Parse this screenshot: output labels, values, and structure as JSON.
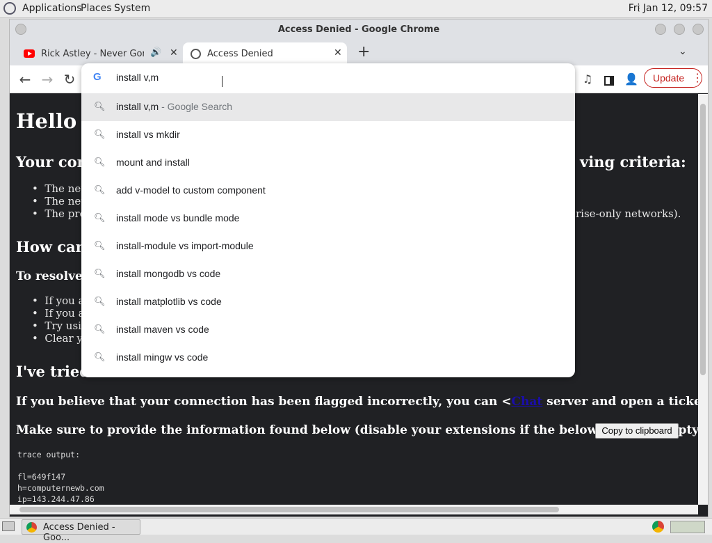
{
  "panel": {
    "menus": [
      "Applications",
      "Places",
      "System"
    ],
    "clock": "Fri Jan 12, 09:57"
  },
  "window": {
    "title": "Access Denied - Google Chrome"
  },
  "tabs": [
    {
      "label": "Rick Astley - Never Gonna"
    },
    {
      "label": "Access Denied"
    }
  ],
  "toolbar": {
    "update_label": "Update"
  },
  "omnibox": {
    "input_value": "install v,m",
    "suggestions": [
      {
        "main": "install v,m",
        "suffix": " - Google Search"
      },
      {
        "main": "install vs mkdir"
      },
      {
        "main": "mount and install"
      },
      {
        "main": "add v-model to custom component"
      },
      {
        "main": "install mode vs bundle mode"
      },
      {
        "main": "install-module vs import-module"
      },
      {
        "main": "install mongodb vs code"
      },
      {
        "main": "install matplotlib vs code"
      },
      {
        "main": "install maven vs code"
      },
      {
        "main": "install mingw vs code"
      }
    ]
  },
  "page": {
    "h1": "Hello th",
    "h2_connection_left": "Your con",
    "h2_connection_right": "ving criteria:",
    "bullets_1": [
      "The netw",
      "The netw",
      "The prov"
    ],
    "bullet_1_3_right": "rise-only networks).",
    "h2_how": "How can",
    "h3_resolve": "To resolve th",
    "bullets_2": [
      "If you ar",
      "If you ar",
      "Try usin",
      "Clear yo"
    ],
    "h2_tried": "I've tried",
    "flagged_before": "If you believe that your connection has been flagged incorrectly, you can <",
    "flagged_link": "Chat",
    "flagged_after": " server and open a ticket.",
    "provide_info": "Make sure to provide the information found below (disable your extensions if the below space is empty):",
    "copy_button": "Copy to clipboard",
    "trace_lines": [
      "trace output:",
      "",
      "fl=649f147",
      "h=computernewb.com",
      "ip=143.244.47.86"
    ]
  },
  "taskbar": {
    "task_label": "Access Denied - Goo..."
  }
}
